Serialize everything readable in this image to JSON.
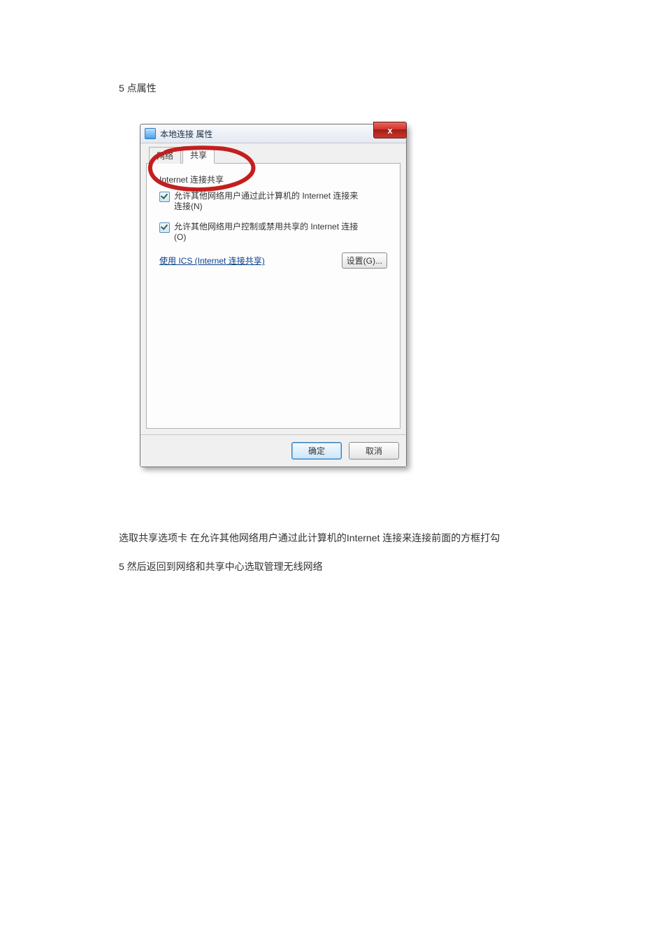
{
  "doc": {
    "step5_title": "5  点属性",
    "after_para1": "选取共享选项卡 在允许其他网络用户通过此计算机的Internet 连接来连接前面的方框打勾",
    "after_para2": "5 然后返回到网络和共享中心选取管理无线网络"
  },
  "dialog": {
    "title": "本地连接 属性",
    "close_glyph": "x",
    "tabs": {
      "network": "网络",
      "share": "共享"
    },
    "group_title": "Internet 连接共享",
    "checkbox1_label": "允许其他网络用户通过此计算机的 Internet 连接来连接(N)",
    "checkbox2_label": "允许其他网络用户控制或禁用共享的 Internet 连接(O)",
    "ics_link": "使用 ICS (Internet 连接共享)",
    "settings_btn": "设置(G)...",
    "ok_btn": "确定",
    "cancel_btn": "取消"
  }
}
